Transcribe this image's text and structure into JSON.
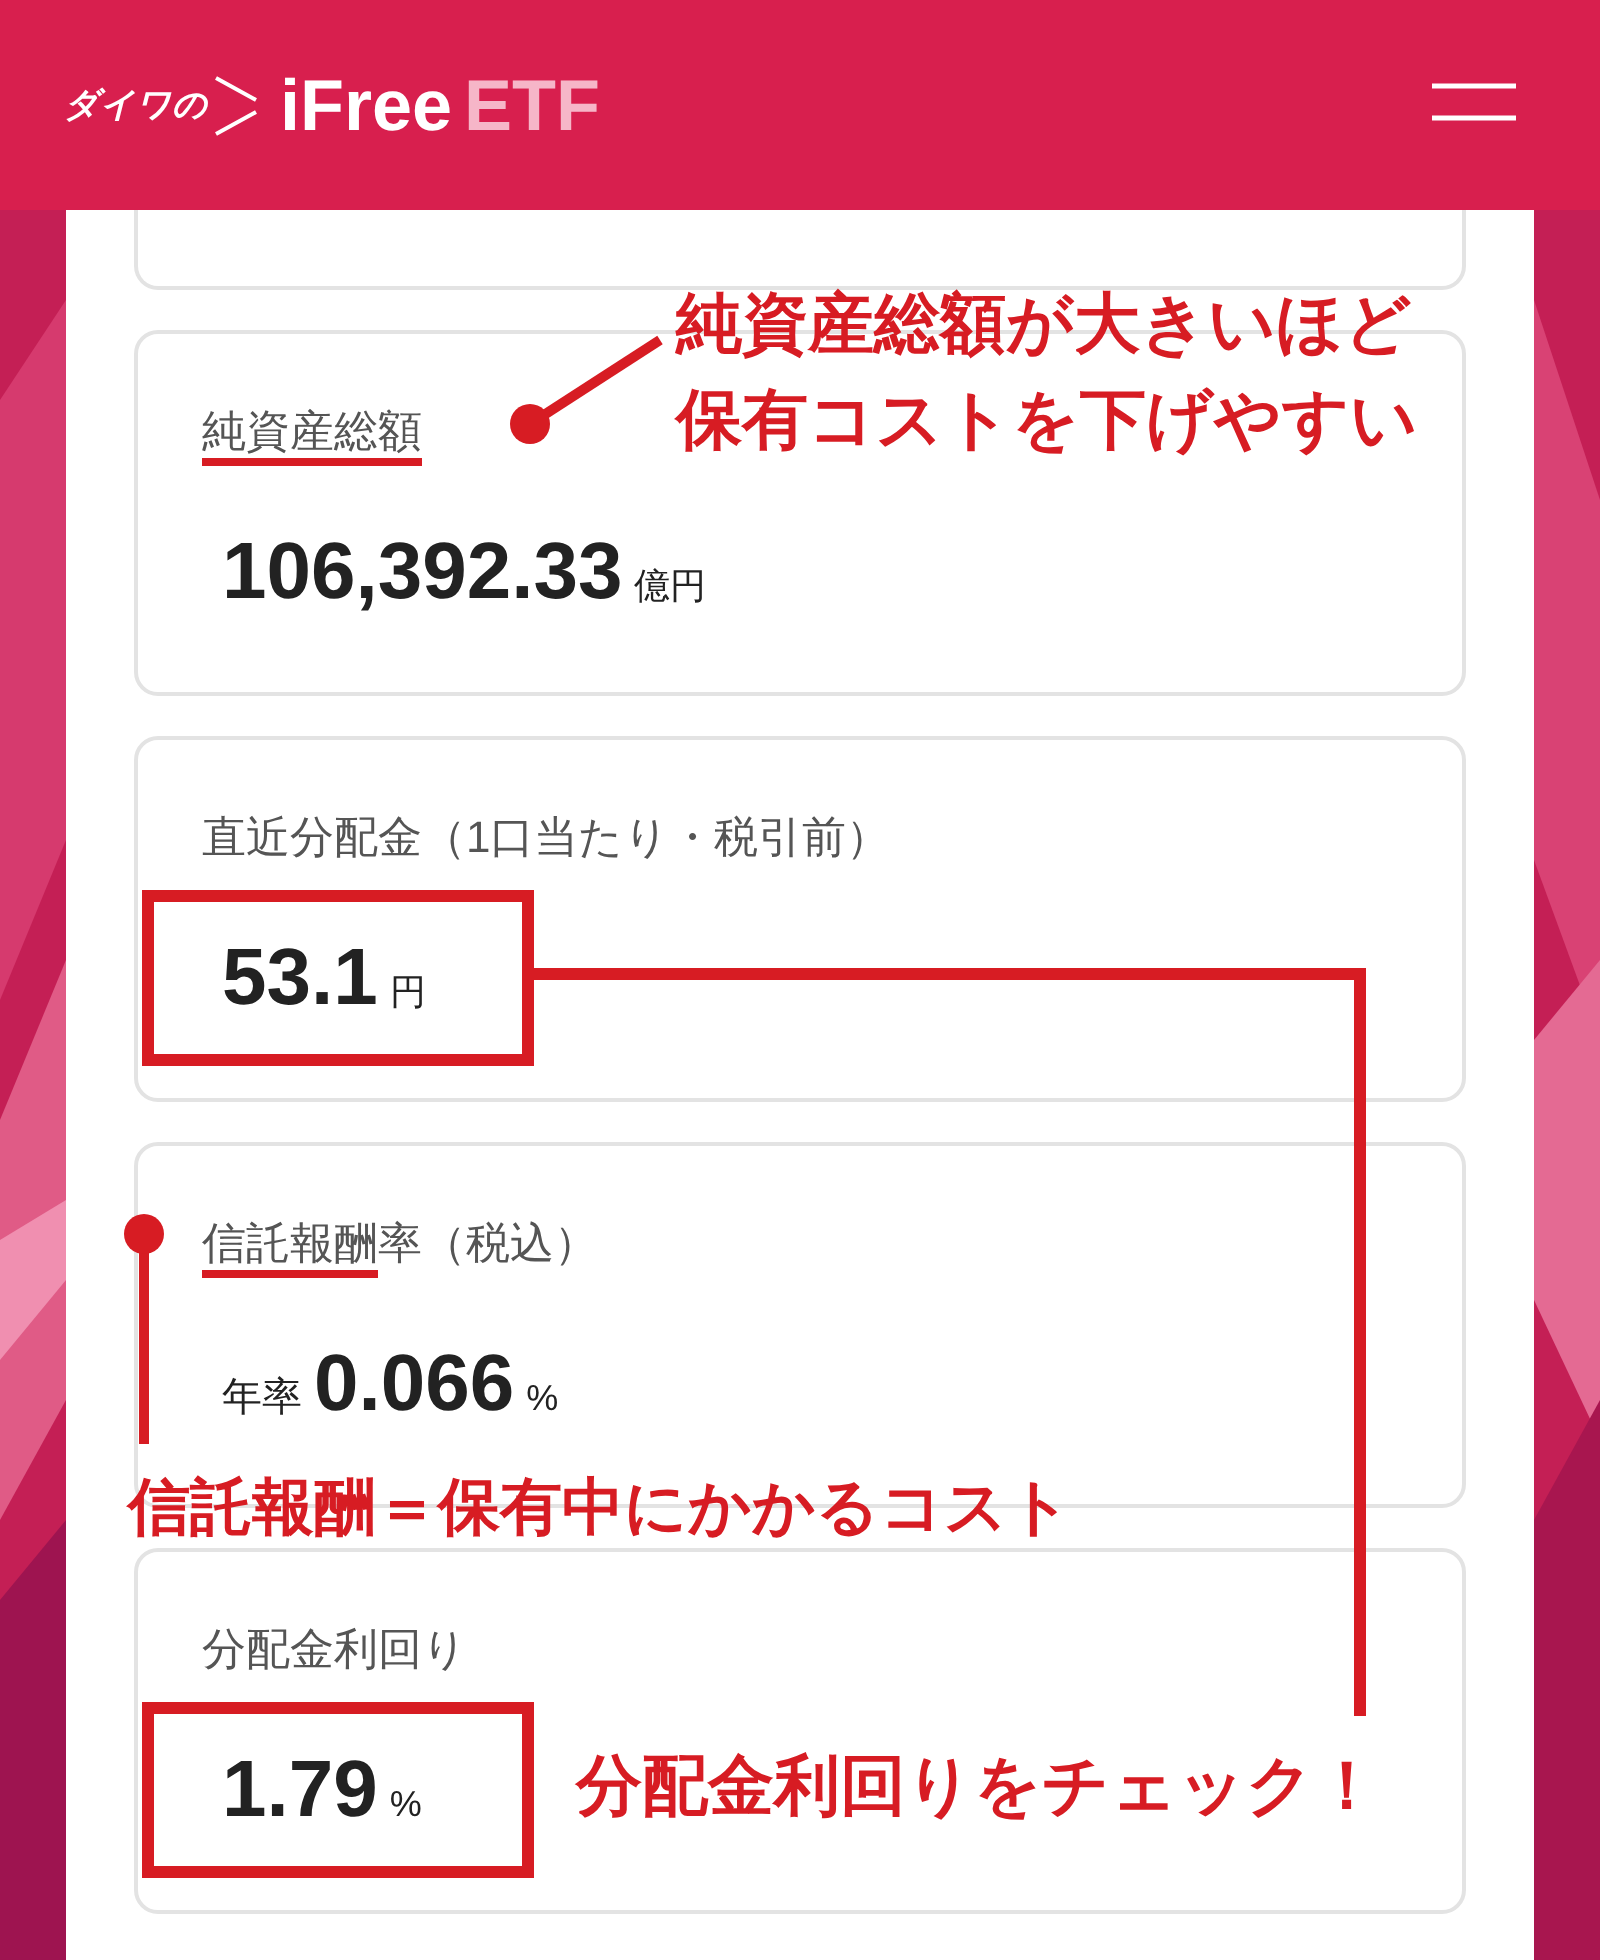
{
  "header": {
    "logo_prefix": "ダイワの",
    "logo_brand": "iFree",
    "logo_suffix": "ETF"
  },
  "cards": [
    {
      "label_marked": "純資産総額",
      "value": "106,392.33",
      "unit": "億円",
      "boxed": false
    },
    {
      "label": "直近分配金（1口当たり・税引前）",
      "value": "53.1",
      "unit": "円",
      "boxed": true
    },
    {
      "label_marked": "信託報酬",
      "label": "率（税込）",
      "prefix": "年率",
      "value": "0.066",
      "unit": "%",
      "boxed": false
    },
    {
      "label": "分配金利回り",
      "value": "1.79",
      "unit": "%",
      "boxed": true
    }
  ],
  "callouts": [
    {
      "lines": [
        "純資産総額が大きいほど",
        "保有コストを下げやすい"
      ]
    },
    {
      "lines": [
        "信託報酬＝保有中にかかるコスト"
      ]
    },
    {
      "lines": [
        "分配金利回りをチェック！"
      ]
    }
  ]
}
